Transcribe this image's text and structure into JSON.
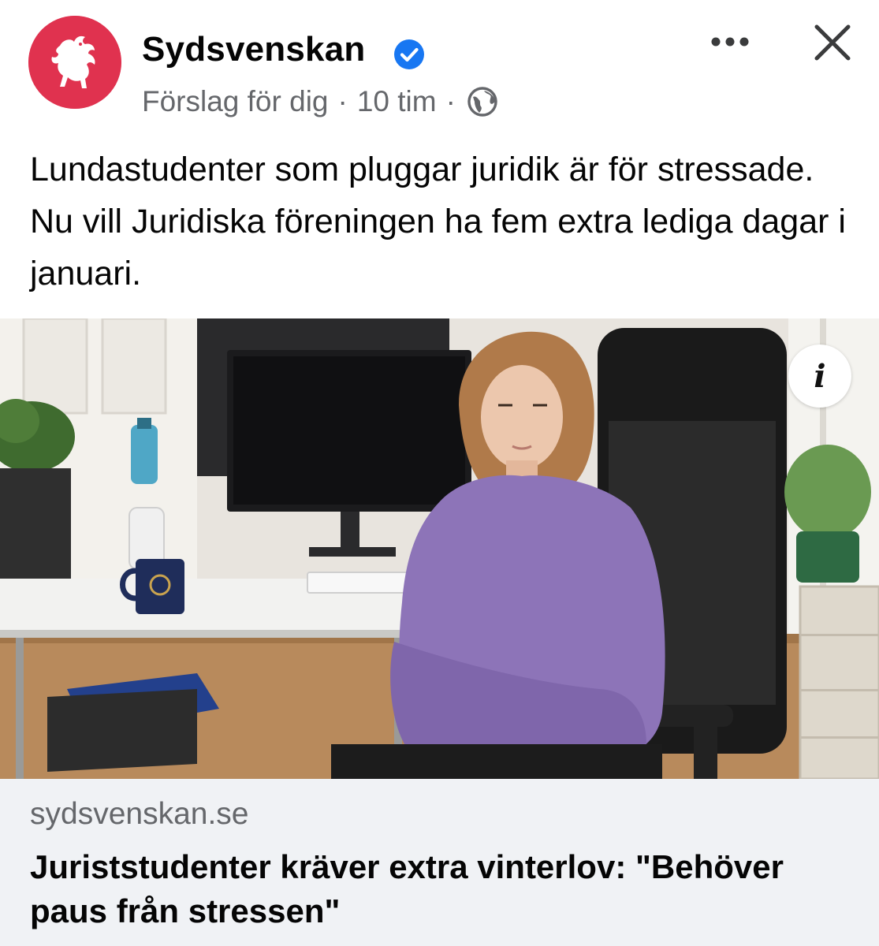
{
  "post": {
    "page_name": "Sydsvenskan",
    "verified": true,
    "meta": {
      "context": "Förslag för dig",
      "separator": "·",
      "time": "10 tim",
      "audience_icon": "globe-icon"
    },
    "text": "Lundastudenter som pluggar juridik är för stressade. Nu vill Juridiska föreningen ha fem extra lediga dagar i januari."
  },
  "header_actions": {
    "more_icon": "more-icon",
    "close_icon": "close-icon"
  },
  "image": {
    "info_label": "i"
  },
  "link_preview": {
    "domain": "sydsvenskan.se",
    "title": "Juriststudenter kräver extra vinterlov: \"Behöver paus från stressen\""
  },
  "colors": {
    "brand": "#e0324f",
    "verified_blue": "#1877f2",
    "secondary_text": "#65676b",
    "link_card_bg": "#f0f2f5"
  }
}
